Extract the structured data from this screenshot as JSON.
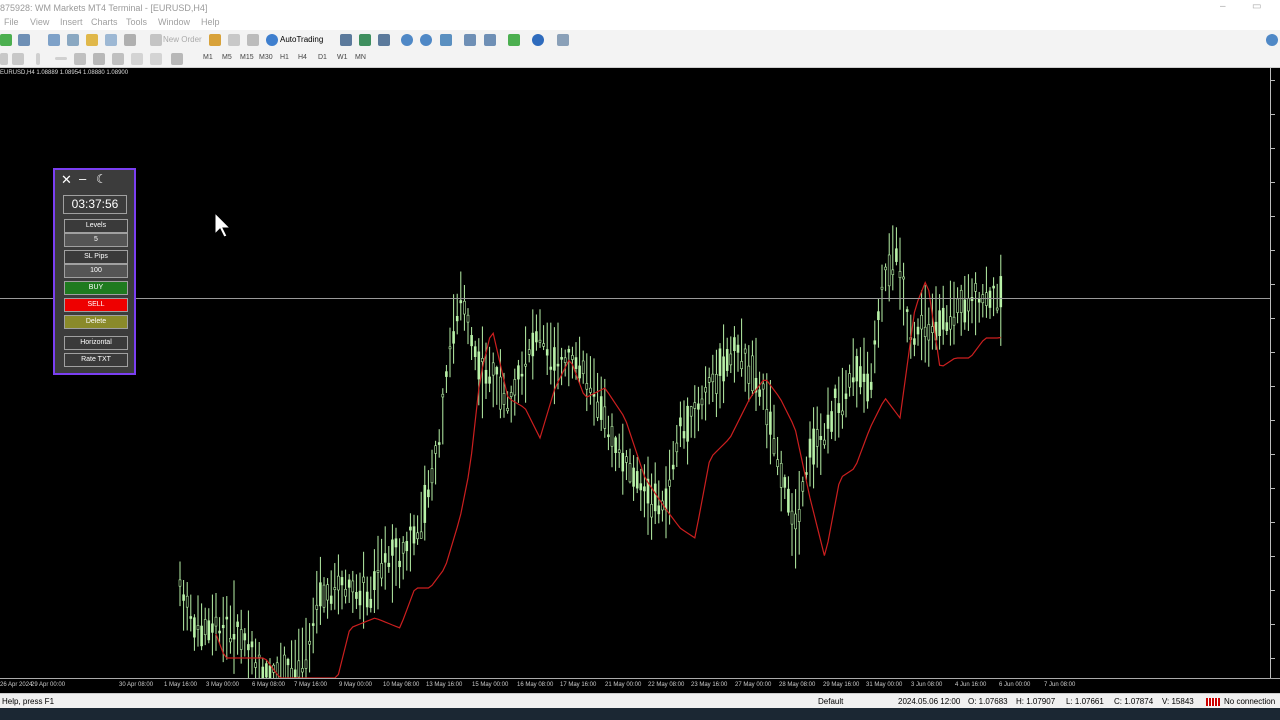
{
  "window": {
    "title": "875928: WM Markets MT4 Terminal - [EURUSD,H4]",
    "min": "–",
    "restore": "▭"
  },
  "menu": [
    "File",
    "View",
    "Insert",
    "Charts",
    "Tools",
    "Window",
    "Help"
  ],
  "toolbar": {
    "new_order": "New Order",
    "autotrading": "AutoTrading"
  },
  "timeframes": [
    "M1",
    "M5",
    "M15",
    "M30",
    "H1",
    "H4",
    "D1",
    "W1",
    "MN"
  ],
  "chart": {
    "symbol_info": "EURUSD,H4  1.08889 1.08954 1.08880 1.08900",
    "x_labels": [
      "26 Apr 2024",
      "29 Apr 00:00",
      "30 Apr 08:00",
      "1 May 16:00",
      "3 May 00:00",
      "6 May 08:00",
      "7 May 16:00",
      "9 May 00:00",
      "10 May 08:00",
      "13 May 16:00",
      "15 May 00:00",
      "16 May 08:00",
      "17 May 16:00",
      "21 May 00:00",
      "22 May 08:00",
      "23 May 16:00",
      "27 May 00:00",
      "28 May 08:00",
      "29 May 16:00",
      "31 May 00:00",
      "3 Jun 08:00",
      "4 Jun 16:00",
      "6 Jun 00:00",
      "7 Jun 08:00"
    ],
    "colors": {
      "candle": "#b8f2a8",
      "ma": "#cc1f1f",
      "background": "#000000"
    }
  },
  "panel": {
    "clock": "03:37:56",
    "levels_label": "Levels",
    "levels_value": "5",
    "sl_label": "SL Pips",
    "sl_value": "100",
    "buy": "BUY",
    "sell": "SELL",
    "delete": "Delete",
    "horizontal": "Horizontal",
    "rate_txt": "Rate TXT",
    "colors": {
      "buy": "#1f7a1f",
      "sell": "#ee0000",
      "delete": "#8a8a2a",
      "border": "#7b3ff2"
    }
  },
  "status": {
    "help": "Help, press F1",
    "profile": "Default",
    "datetime": "2024.05.06 12:00",
    "open": "O: 1.07683",
    "high": "H: 1.07907",
    "low": "L: 1.07661",
    "close": "C: 1.07874",
    "volume": "V: 15843",
    "connection": "No connection"
  }
}
